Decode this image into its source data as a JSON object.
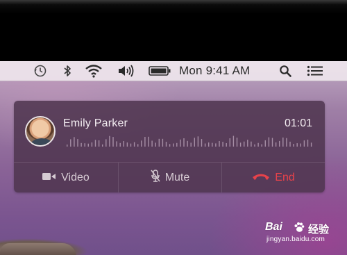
{
  "menubar": {
    "clock": "Mon 9:41 AM",
    "icons": [
      "time-machine-icon",
      "bluetooth-icon",
      "wifi-icon",
      "volume-icon",
      "battery-icon",
      "spotlight-search-icon",
      "notification-center-icon"
    ]
  },
  "call": {
    "caller_name": "Emily Parker",
    "duration": "01:01",
    "actions": {
      "video_label": "Video",
      "mute_label": "Mute",
      "end_label": "End"
    },
    "end_color": "#e8424a"
  },
  "watermark": {
    "brand": "Bai",
    "brand_suffix": "经验",
    "url": "jingyan.baidu.com"
  }
}
